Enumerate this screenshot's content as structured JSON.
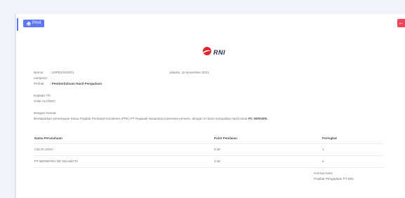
{
  "toolbar": {
    "print_label": "Print"
  },
  "logo": {
    "text": "RNI"
  },
  "letter": {
    "nomor_label": "Nomor",
    "nomor_value": ": 10/PBJ/XI/2021",
    "lampiran_label": "Lampiran",
    "lampiran_value": ": -",
    "perihal_label": "Perihal",
    "perihal_value": ": Pemberitahuan Hasil Pengadaan",
    "place_date": "Jakarta, 15 November 2021",
    "kepada": "Kepada Yth",
    "recipient": "XABI ALONSO",
    "greeting": "Dengan hormat",
    "body_text": "Berdasarkan persetujuan Ketua Pejabat Pembuat Komitmen (PPK) PT Rajawali Nusantara Indonesia persero, dengan ini kami sampaikan hasil untuk",
    "body_item": "PC SERVER."
  },
  "table": {
    "headers": [
      "Nama Perusahaan",
      "Point Penilaian",
      "Peringkat"
    ],
    "rows": [
      [
        "CELTA VIGO",
        "9.00",
        "1"
      ],
      [
        "PT BERMITRA DE NGAMOTA",
        "0.00",
        "2"
      ]
    ]
  },
  "closing": {
    "hormat": "Hormat Kami",
    "signer": "Pejabat Pengadaan PT RNI"
  },
  "colors": {
    "accent": "#5d78ff",
    "danger": "#f0455a",
    "logo_red": "#e4262c",
    "logo_navy": "#1f2a55"
  }
}
